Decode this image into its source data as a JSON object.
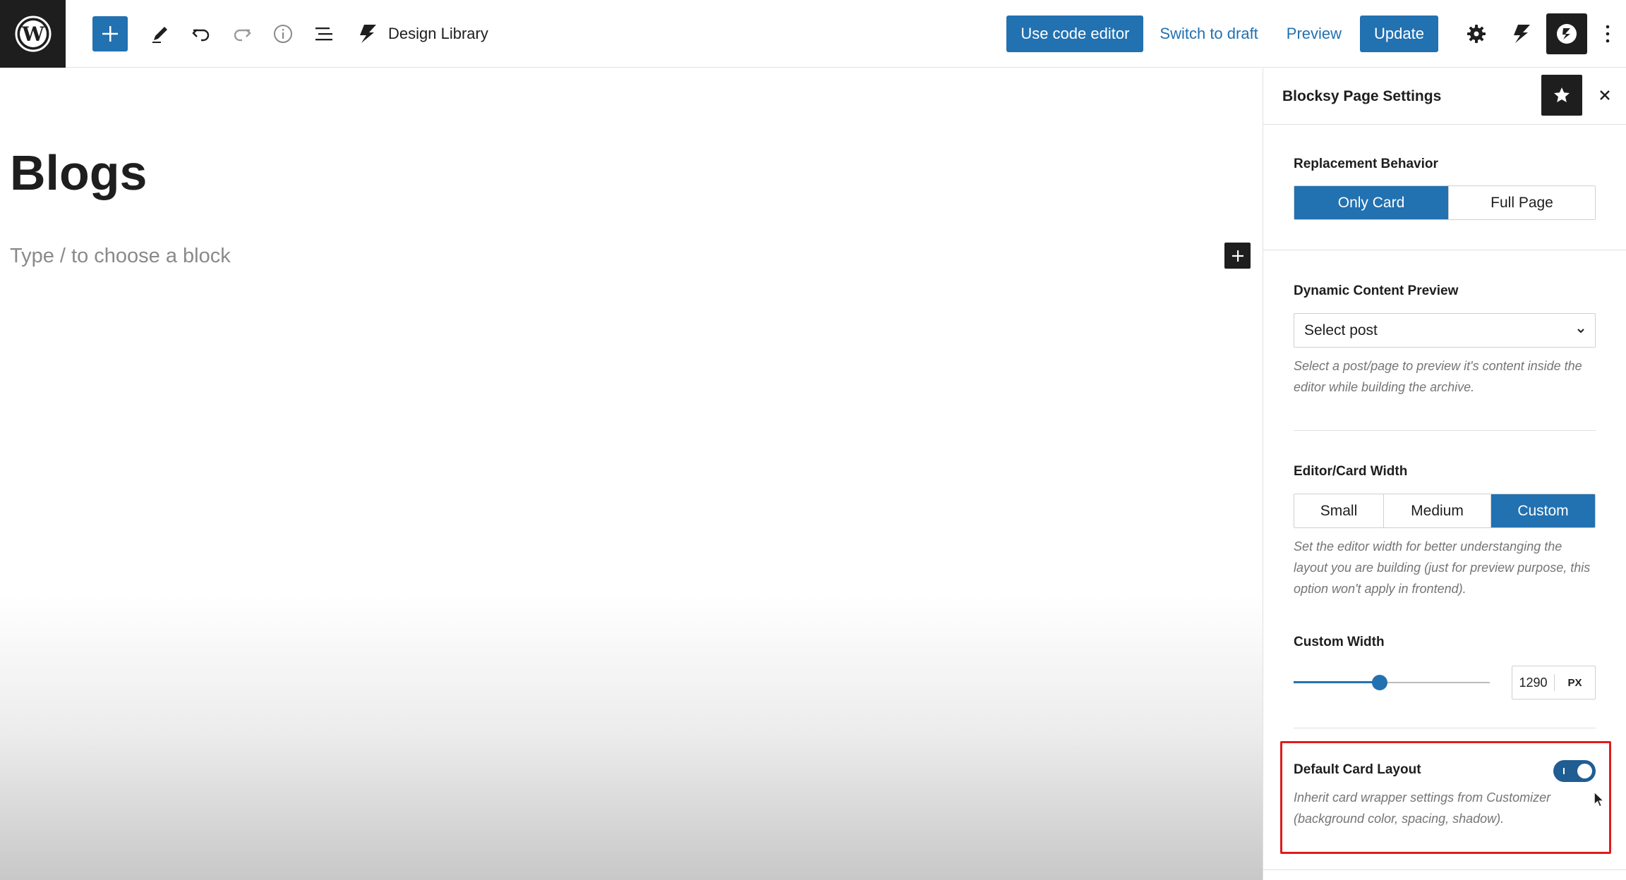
{
  "toolbar": {
    "design_library_label": "Design Library",
    "code_editor_label": "Use code editor",
    "switch_draft_label": "Switch to draft",
    "preview_label": "Preview",
    "update_label": "Update"
  },
  "editor": {
    "page_title": "Blogs",
    "block_placeholder": "Type / to choose a block"
  },
  "sidebar": {
    "title": "Blocksy Page Settings",
    "replacement_behavior": {
      "label": "Replacement Behavior",
      "options": [
        "Only Card",
        "Full Page"
      ],
      "selected": "Only Card"
    },
    "dynamic_preview": {
      "label": "Dynamic Content Preview",
      "select_value": "Select post",
      "help": "Select a post/page to preview it's content inside the editor while building the archive."
    },
    "card_width": {
      "label": "Editor/Card Width",
      "options": [
        "Small",
        "Medium",
        "Custom"
      ],
      "selected": "Custom",
      "help": "Set the editor width for better understanging the layout you are building (just for preview purpose, this option won't apply in frontend)."
    },
    "custom_width": {
      "label": "Custom Width",
      "value": "1290",
      "unit": "PX",
      "slider_fraction": 0.44
    },
    "default_card_layout": {
      "label": "Default Card Layout",
      "enabled": true,
      "help": "Inherit card wrapper settings from Customizer (background color, spacing, shadow)."
    }
  },
  "colors": {
    "accent": "#2271b1",
    "toggle_on": "#1f5d93",
    "highlight": "#e01b1b",
    "dark": "#1e1e1e"
  }
}
